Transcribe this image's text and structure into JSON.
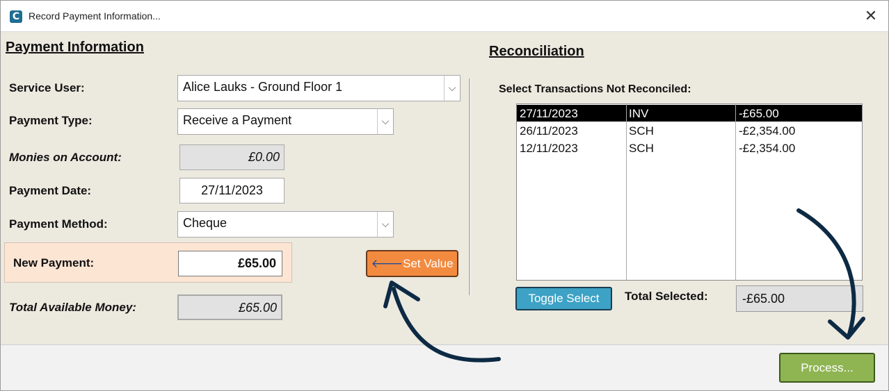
{
  "window": {
    "title": "Record Payment Information...",
    "close_glyph": "✕",
    "app_icon_letter": "C"
  },
  "payment": {
    "section_title": "Payment Information",
    "service_user": {
      "label": "Service User:",
      "value": "Alice Lauks - Ground Floor 1"
    },
    "payment_type": {
      "label": "Payment Type:",
      "value": "Receive a Payment"
    },
    "monies_on_account": {
      "label": "Monies on Account:",
      "value": "£0.00"
    },
    "payment_date": {
      "label": "Payment Date:",
      "value": "27/11/2023"
    },
    "payment_method": {
      "label": "Payment Method:",
      "value": "Cheque"
    },
    "new_payment": {
      "label": "New Payment:",
      "value": "£65.00"
    },
    "set_value_button": {
      "icon": "arrow-left-icon",
      "label": "Set Value"
    },
    "total_available": {
      "label": "Total Available Money:",
      "value": "£65.00"
    }
  },
  "reconciliation": {
    "section_title": "Reconciliation",
    "list_label": "Select Transactions Not Reconciled:",
    "transactions": [
      {
        "date": "27/11/2023",
        "type": "INV",
        "amount": "-£65.00",
        "selected": true
      },
      {
        "date": "26/11/2023",
        "type": "SCH",
        "amount": "-£2,354.00",
        "selected": false
      },
      {
        "date": "12/11/2023",
        "type": "SCH",
        "amount": "-£2,354.00",
        "selected": false
      }
    ],
    "toggle_button": "Toggle Select",
    "total_selected_label": "Total Selected:",
    "total_selected_value": "-£65.00"
  },
  "footer": {
    "process_button": "Process..."
  },
  "colors": {
    "window_bg": "#ece9df",
    "set_value_bg": "#f28b40",
    "toggle_bg": "#3da2c5",
    "process_bg": "#8fb553",
    "new_payment_panel": "#fde5d4",
    "annotation_arrow": "#0d2a44"
  },
  "icons": {
    "dropdown": "chevron-down-icon",
    "close": "close-icon",
    "app": "app-logo-icon"
  }
}
